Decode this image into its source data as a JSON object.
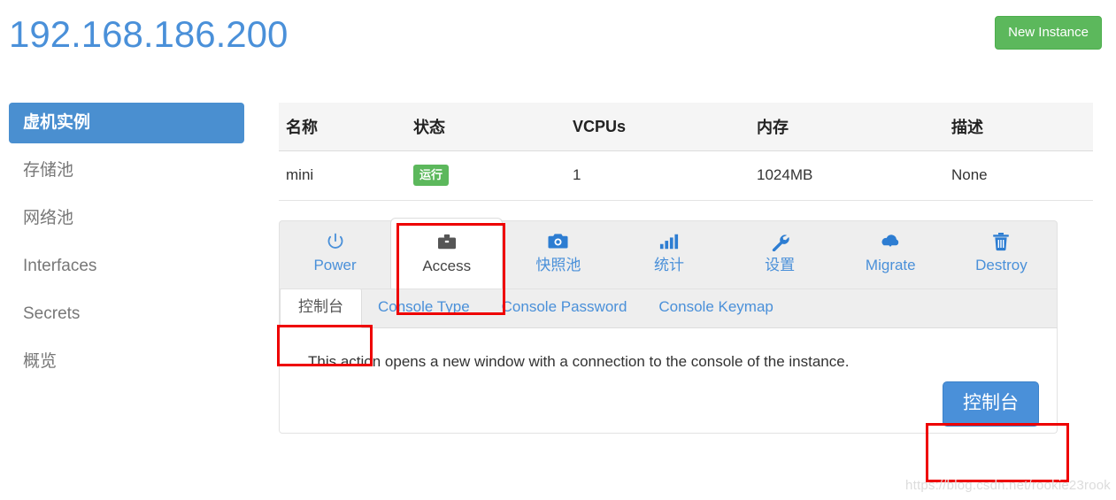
{
  "header": {
    "title": "192.168.186.200",
    "new_instance_label": "New Instance"
  },
  "sidebar": {
    "items": [
      {
        "label": "虚机实例",
        "active": true
      },
      {
        "label": "存储池",
        "active": false
      },
      {
        "label": "网络池",
        "active": false
      },
      {
        "label": "Interfaces",
        "active": false
      },
      {
        "label": "Secrets",
        "active": false
      },
      {
        "label": "概览",
        "active": false
      }
    ]
  },
  "instance_table": {
    "columns": [
      "名称",
      "状态",
      "VCPUs",
      "内存",
      "描述"
    ],
    "rows": [
      {
        "name": "mini",
        "state": "运行",
        "vcpus": "1",
        "memory": "1024MB",
        "description": "None"
      }
    ]
  },
  "action_tabs": [
    {
      "label": "Power",
      "icon": "power-icon",
      "active": false
    },
    {
      "label": "Access",
      "icon": "briefcase-icon",
      "active": true
    },
    {
      "label": "快照池",
      "icon": "camera-icon",
      "active": false
    },
    {
      "label": "统计",
      "icon": "bar-chart-icon",
      "active": false
    },
    {
      "label": "设置",
      "icon": "wrench-icon",
      "active": false
    },
    {
      "label": "Migrate",
      "icon": "cloud-download-icon",
      "active": false
    },
    {
      "label": "Destroy",
      "icon": "trash-icon",
      "active": false
    }
  ],
  "sub_tabs": [
    {
      "label": "控制台",
      "active": true
    },
    {
      "label": "Console Type",
      "active": false
    },
    {
      "label": "Console Password",
      "active": false
    },
    {
      "label": "Console Keymap",
      "active": false
    }
  ],
  "console_panel": {
    "description": "This action opens a new window with a connection to the console of the instance.",
    "button_label": "控制台"
  },
  "watermark": "https://blog.csdn.net/rookie23rook",
  "colors": {
    "title_blue": "#4a90d9",
    "primary_blue": "#4a90d9",
    "sidebar_active": "#4a8fd0",
    "success_green": "#5cb85c",
    "annotation_red": "#ee0000",
    "panel_grey": "#eeeeee",
    "table_header_grey": "#f5f5f5"
  }
}
